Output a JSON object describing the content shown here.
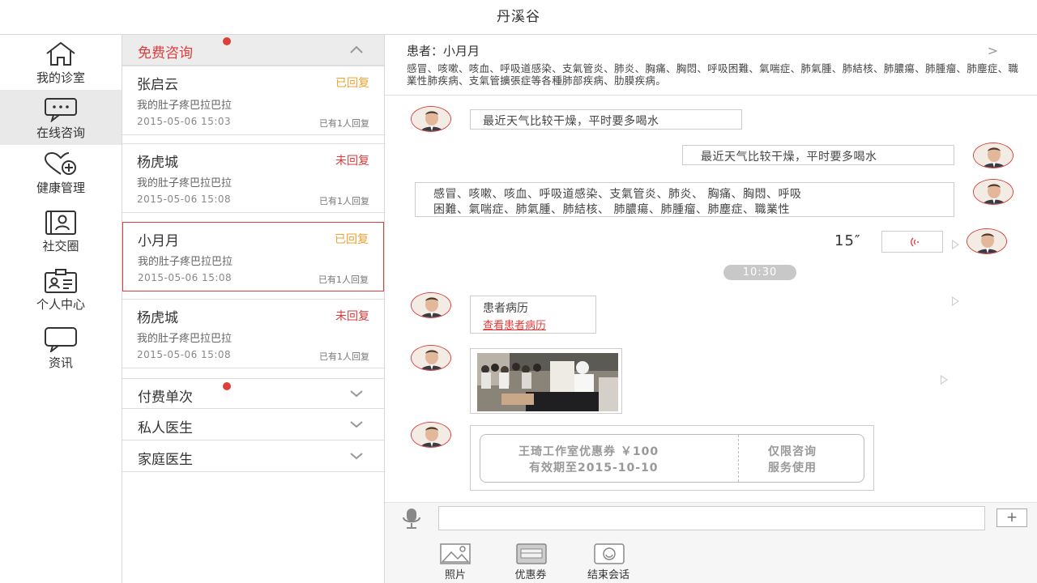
{
  "window": {
    "title": "丹溪谷"
  },
  "nav": {
    "items": [
      {
        "label": "我的诊室",
        "icon": "home-icon"
      },
      {
        "label": "在线咨询",
        "icon": "chat-dots-icon",
        "active": true
      },
      {
        "label": "健康管理",
        "icon": "heart-plus-icon"
      },
      {
        "label": "社交圈",
        "icon": "contacts-book-icon"
      },
      {
        "label": "个人中心",
        "icon": "id-card-icon"
      },
      {
        "label": "资讯",
        "icon": "speech-bubble-icon"
      }
    ]
  },
  "list": {
    "sections": [
      {
        "title": "免费咨询",
        "expanded": true,
        "has_dot": true
      },
      {
        "title": "付费单次",
        "expanded": false,
        "has_dot": true
      },
      {
        "title": "私人医生",
        "expanded": false,
        "has_dot": false
      },
      {
        "title": "家庭医生",
        "expanded": false,
        "has_dot": false
      }
    ],
    "cards": [
      {
        "name": "张启云",
        "status": "已回复",
        "status_color": "#f0a030",
        "message": "我的肚子疼巴拉巴拉",
        "time": "2015-05-06 15:03",
        "count": "已有1人回复"
      },
      {
        "name": "杨虎城",
        "status": "未回复",
        "status_color": "#e03a3a",
        "message": "我的肚子疼巴拉巴拉",
        "time": "2015-05-06 15:08",
        "count": "已有1人回复"
      },
      {
        "name": "小月月",
        "status": "已回复",
        "status_color": "#f0a030",
        "message": "我的肚子疼巴拉巴拉",
        "time": "2015-05-06 15:08",
        "count": "已有1人回复",
        "selected": true
      },
      {
        "name": "杨虎城",
        "status": "未回复",
        "status_color": "#e03a3a",
        "message": "我的肚子疼巴拉巴拉",
        "time": "2015-05-06 15:08",
        "count": "已有1人回复"
      }
    ]
  },
  "chat": {
    "patient": {
      "label": "患者：小月月",
      "tags": "感冒、咳嗽、咳血、呼吸道感染、支氣管炎、肺炎、胸痛、胸悶、呼吸困難、氣喘症、肺氣腫、肺結核、肺膿瘍、肺腫瘤、肺塵症、職業性肺疾病、支氣管擴張症等各種肺部疾病、肋膜疾病。"
    },
    "messages": {
      "m1": "最近天气比较干燥，平时要多喝水",
      "m2": "最近天气比较干燥，平时要多喝水",
      "m3_line1": "感冒、咳嗽、咳血、呼吸道感染、支氣管炎、肺炎、 胸痛、胸悶、呼吸",
      "m3_line2": "困難、氣喘症、肺氣腫、肺結核、 肺膿瘍、肺腫瘤、肺塵症、職業性",
      "voice_duration": "15″",
      "time_divider": "10:30",
      "record_title": "患者病历",
      "record_link": "查看患者病历"
    },
    "coupon": {
      "line1": "王琦工作室优惠券 ￥100",
      "line2": "有效期至2015-10-10",
      "right1": "仅限咨询",
      "right2": "服务使用"
    },
    "input": {
      "placeholder": ""
    },
    "plus_label": "+",
    "tools": [
      {
        "label": "照片",
        "icon": "photo-icon"
      },
      {
        "label": "优惠券",
        "icon": "coupon-icon"
      },
      {
        "label": "结束会话",
        "icon": "end-session-icon"
      }
    ]
  },
  "colors": {
    "accent": "#e03a3a",
    "replied": "#f0a030",
    "border": "#d8d8d8"
  }
}
